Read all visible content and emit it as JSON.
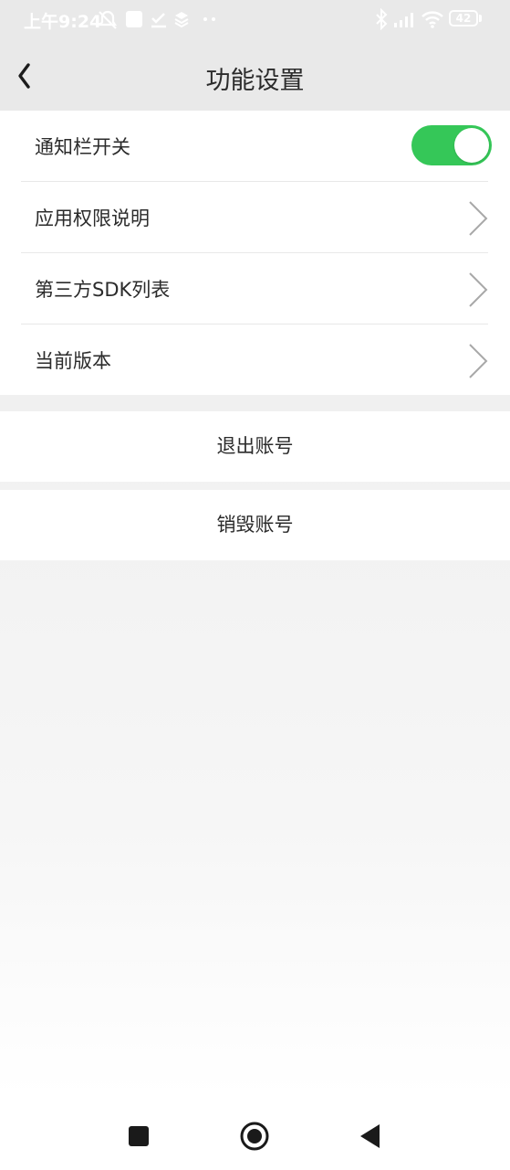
{
  "status_bar": {
    "time": "上午9:24",
    "battery": "42"
  },
  "header": {
    "title": "功能设置"
  },
  "settings": {
    "items": [
      {
        "label": "通知栏开关",
        "control": "toggle",
        "toggle_on": true
      },
      {
        "label": "应用权限说明",
        "control": "chevron"
      },
      {
        "label": "第三方SDK列表",
        "control": "chevron"
      },
      {
        "label": "当前版本",
        "control": "chevron"
      }
    ]
  },
  "actions": {
    "logout_label": "退出账号",
    "delete_account_label": "销毁账号"
  },
  "colors": {
    "toggle_on": "#35c758",
    "header_bg": "#e9e9e9",
    "text": "#2b2b2b"
  },
  "nav_bar": {
    "icons": [
      "recents-square-icon",
      "home-circle-icon",
      "back-triangle-icon"
    ]
  }
}
